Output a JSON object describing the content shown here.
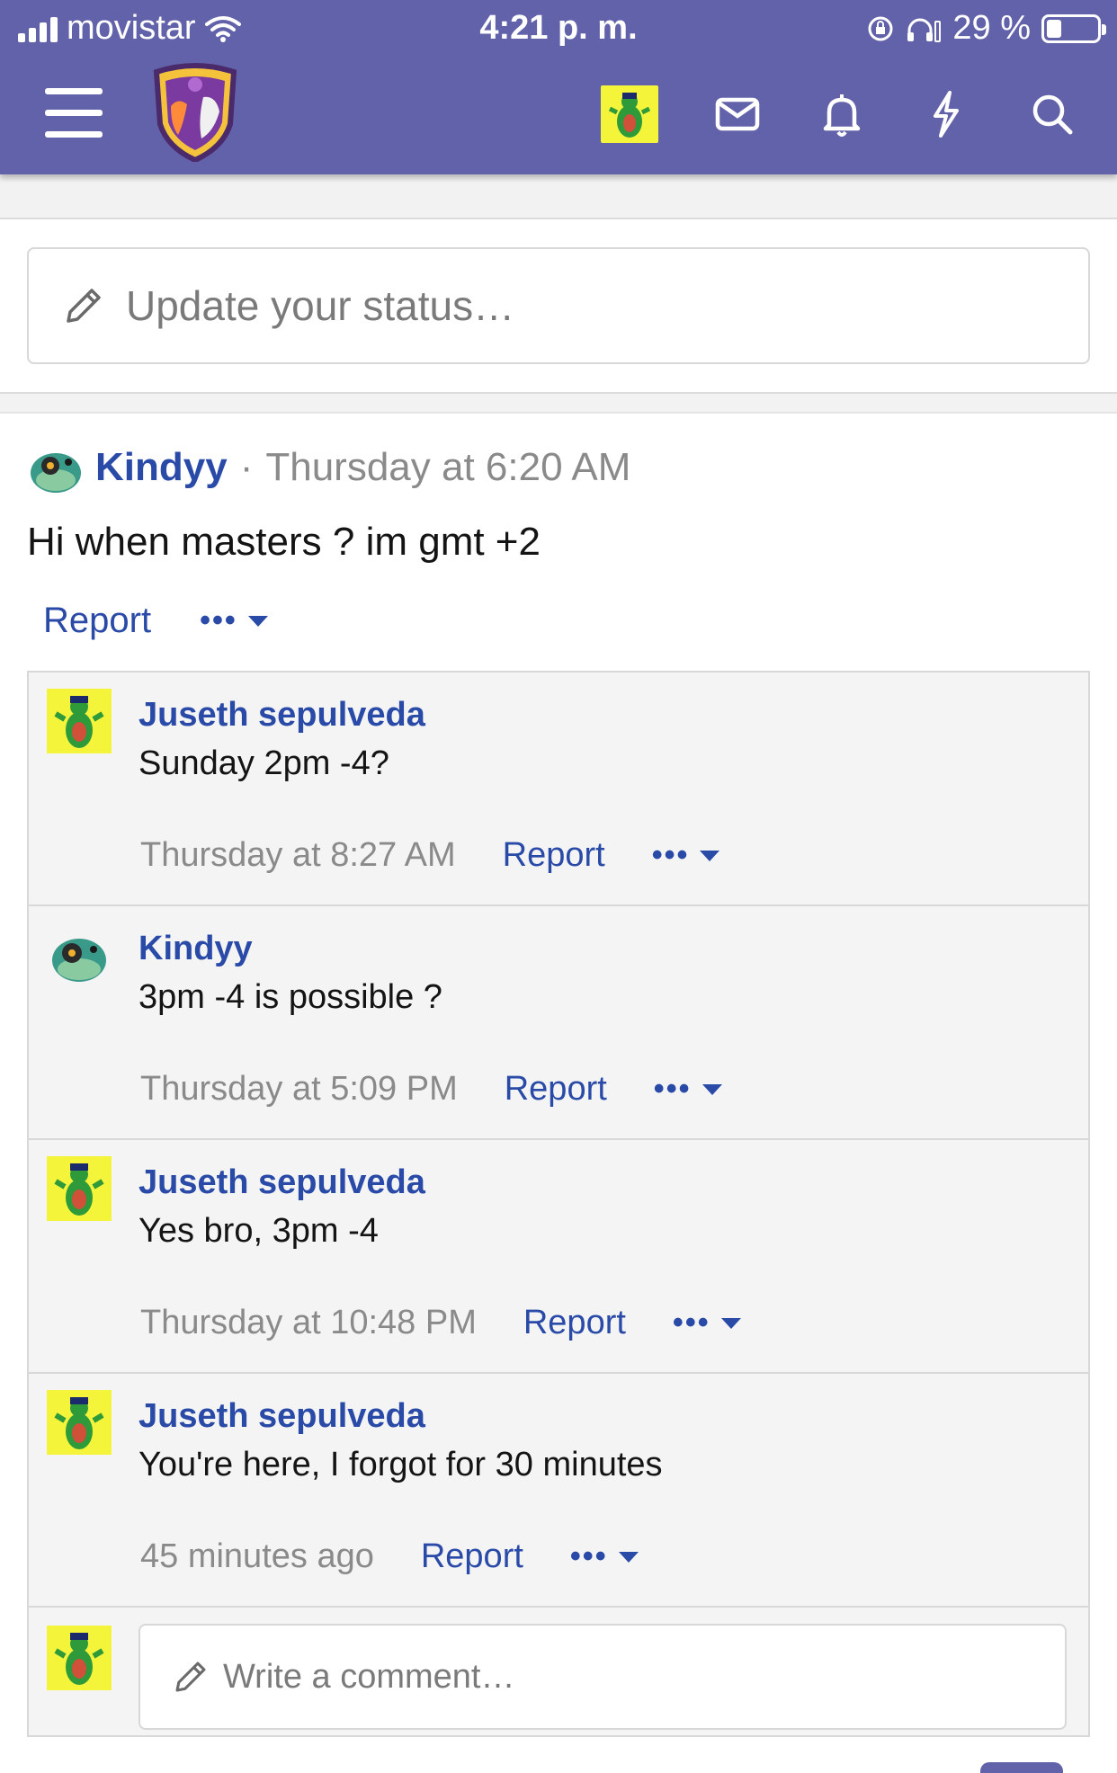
{
  "status_bar": {
    "carrier": "movistar",
    "time": "4:21 p. m.",
    "battery": "29 %",
    "battery_level": 0.29
  },
  "header": {
    "icons": [
      "menu-icon",
      "site-logo",
      "user-avatar",
      "mail-icon",
      "bell-icon",
      "bolt-icon",
      "search-icon"
    ]
  },
  "status_update": {
    "placeholder": "Update your status…"
  },
  "post": {
    "author": "Kindyy",
    "separator": "·",
    "time": "Thursday at 6:20 AM",
    "text": "Hi when masters ? im gmt +2",
    "report_label": "Report",
    "more_label": "•••"
  },
  "comments": [
    {
      "author": "Juseth sepulveda",
      "text": "Sunday 2pm -4?",
      "time": "Thursday at 8:27 AM",
      "report_label": "Report",
      "more_label": "•••"
    },
    {
      "author": "Kindyy",
      "text": "3pm -4 is possible ?",
      "time": "Thursday at 5:09 PM",
      "report_label": "Report",
      "more_label": "•••"
    },
    {
      "author": "Juseth sepulveda",
      "text": "Yes bro, 3pm -4",
      "time": "Thursday at 10:48 PM",
      "report_label": "Report",
      "more_label": "•••"
    },
    {
      "author": "Juseth sepulveda",
      "text": "You're here, I forgot for 30 minutes",
      "time": "45 minutes ago",
      "report_label": "Report",
      "more_label": "•••"
    }
  ],
  "comment_compose": {
    "placeholder": "Write a comment…"
  },
  "colors": {
    "header": "#6262aa",
    "link": "#2a4aa8",
    "avatar_bg": "#f4f43a"
  }
}
